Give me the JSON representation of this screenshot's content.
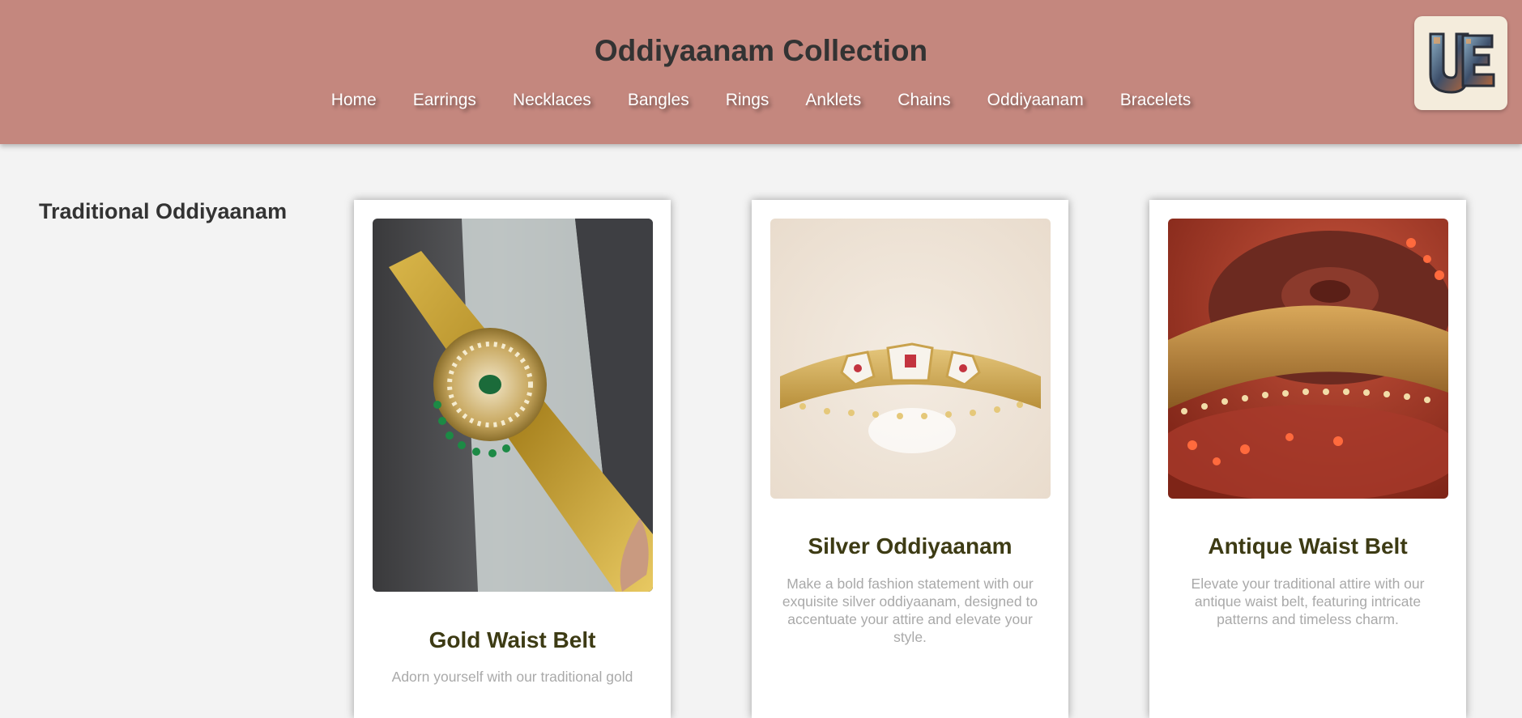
{
  "header": {
    "title": "Oddiyaanam Collection",
    "nav": [
      "Home",
      "Earrings",
      "Necklaces",
      "Bangles",
      "Rings",
      "Anklets",
      "Chains",
      "Oddiyaanam",
      "Bracelets"
    ],
    "logo_text": "UE"
  },
  "section": {
    "title": "Traditional Oddiyaanam"
  },
  "cards": [
    {
      "title": "Gold Waist Belt",
      "description": "Adorn yourself with our traditional gold"
    },
    {
      "title": "Silver Oddiyaanam",
      "description": "Make a bold fashion statement with our exquisite silver oddiyaanam, designed to accentuate your attire and elevate your style."
    },
    {
      "title": "Antique Waist Belt",
      "description": "Elevate your traditional attire with our antique waist belt, featuring intricate patterns and timeless charm."
    }
  ],
  "colors": {
    "header_bg": "#c4877e",
    "page_bg": "#f3f3f3",
    "card_title": "#3d3b14",
    "card_desc": "#a9a9a9"
  }
}
